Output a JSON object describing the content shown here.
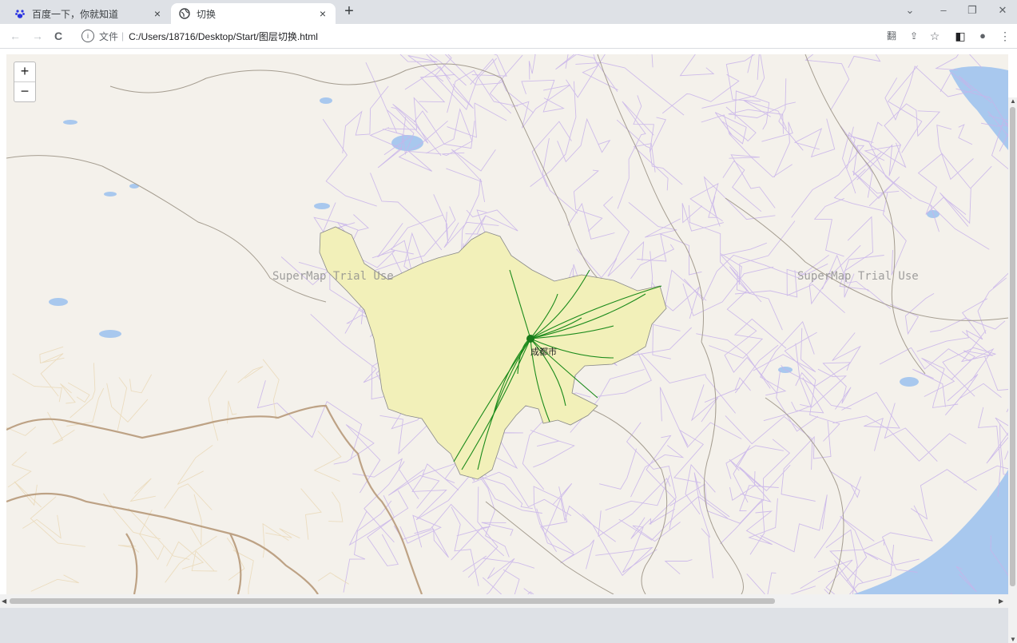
{
  "browser": {
    "tabs": [
      {
        "title": "百度一下，你就知道",
        "icon": "baidu-paw-icon",
        "active": false
      },
      {
        "title": "切换",
        "icon": "globe-icon",
        "active": true
      }
    ],
    "close_glyph": "×",
    "new_tab_glyph": "+",
    "window_controls": {
      "dropdown": "⌄",
      "minimize": "–",
      "restore": "❐",
      "close": "✕"
    },
    "nav": {
      "back": "←",
      "forward": "→",
      "reload": "C"
    },
    "address": {
      "info_glyph": "i",
      "scheme_label": "文件",
      "separator": "|",
      "url": "C:/Users/18716/Desktop/Start/图层切换.html"
    },
    "toolbar_icons": {
      "translate": "翻",
      "share": "⇪",
      "bookmark": "☆",
      "sidepanel": "◧",
      "profile": "●",
      "menu": "⋮"
    }
  },
  "map": {
    "zoom_in": "+",
    "zoom_out": "−",
    "watermarks": [
      "SuperMap Trial Use",
      "SuperMap Trial Use"
    ],
    "city_label": "成都市",
    "colors": {
      "background": "#f4f1eb",
      "province_fill": "#f2f0b9",
      "roads": "#c8b3ea",
      "borders": "#a59d90",
      "intl_border": "#b89a7a",
      "water": "#a8c8ee",
      "rail": "#1a8a1a"
    }
  }
}
